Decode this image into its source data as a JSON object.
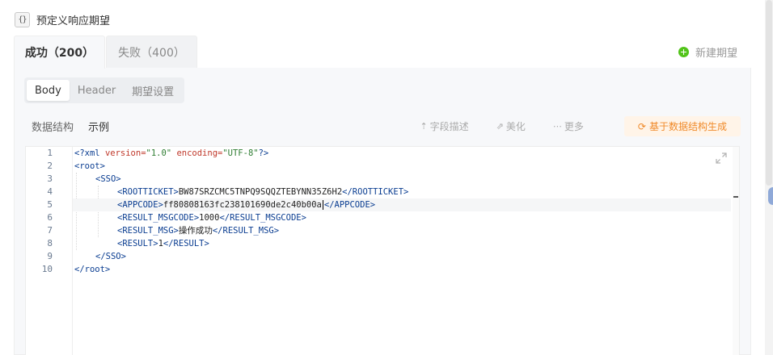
{
  "header": {
    "icon": "braces-icon",
    "icon_glyph": "{}",
    "title": "预定义响应期望"
  },
  "tabs": [
    {
      "label": "成功（200）",
      "active": true
    },
    {
      "label": "失败（400）",
      "active": false
    }
  ],
  "add_expectation": {
    "label": "新建期望",
    "icon": "plus-circle-icon",
    "icon_color": "#52c41a"
  },
  "segments": [
    {
      "label": "Body",
      "active": true
    },
    {
      "label": "Header",
      "active": false
    },
    {
      "label": "期望设置",
      "active": false
    }
  ],
  "view_tabs": [
    {
      "label": "数据结构",
      "active": false
    },
    {
      "label": "示例",
      "active": true
    }
  ],
  "toolbar": {
    "field_desc": {
      "label": "字段描述",
      "icon": "upload-icon",
      "glyph": "⇡"
    },
    "beautify": {
      "label": "美化",
      "icon": "magic-wand-icon",
      "glyph": "⇗"
    },
    "more": {
      "label": "更多",
      "icon": "more-icon",
      "glyph": "⋯"
    },
    "generate": {
      "label": "基于数据结构生成",
      "icon": "refresh-icon",
      "glyph": "⟳",
      "color": "#f08a2a",
      "bg": "#fff4e8"
    }
  },
  "editor": {
    "line_numbers": [
      "1",
      "2",
      "3",
      "4",
      "5",
      "6",
      "7",
      "8",
      "9",
      "10"
    ],
    "lines": {
      "l1_decl_open": "<?xml ",
      "l1_attr1": "version=",
      "l1_val1": "\"1.0\"",
      "l1_attr2": " encoding=",
      "l1_val2": "\"UTF-8\"",
      "l1_decl_close": "?>",
      "l2": "<root>",
      "l3": "<SSO>",
      "l4_open": "<ROOTTICKET>",
      "l4_text": "BW87SRZCMC5TNPQ9SQQZTEBYNN35Z6H2",
      "l4_close": "</ROOTTICKET>",
      "l5_open": "<APPCODE>",
      "l5_text": "ff80808163fc238101690de2c40b00a",
      "l5_close": "</APPCODE>",
      "l6_open": "<RESULT_MSGCODE>",
      "l6_text": "1000",
      "l6_close": "</RESULT_MSGCODE>",
      "l7_open": "<RESULT_MSG>",
      "l7_text": "操作成功",
      "l7_close": "</RESULT_MSG>",
      "l8_open": "<RESULT>",
      "l8_text": "1",
      "l8_close": "</RESULT>",
      "l9": "</SSO>",
      "l10": "</root>"
    },
    "expand_icon": "expand-icon"
  }
}
